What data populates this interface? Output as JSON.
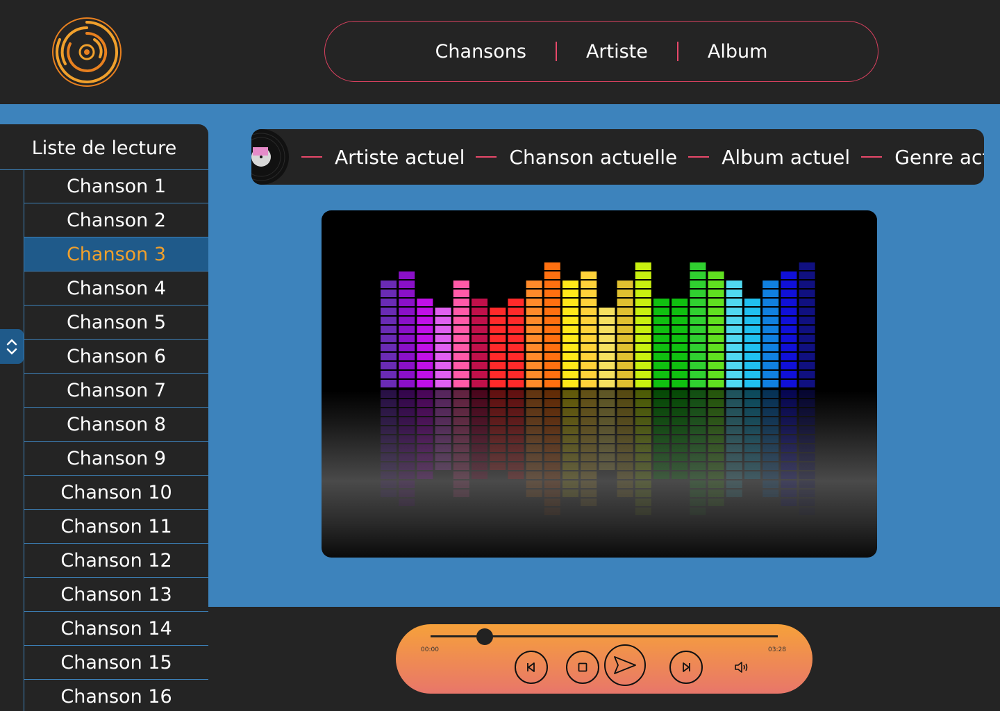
{
  "nav": {
    "items": [
      "Chansons",
      "Artiste",
      "Album"
    ]
  },
  "playlist": {
    "title": "Liste de lecture",
    "songs": [
      "Chanson 1",
      "Chanson 2",
      "Chanson 3",
      "Chanson 4",
      "Chanson 5",
      "Chanson 6",
      "Chanson 7",
      "Chanson 8",
      "Chanson 9",
      "Chanson 10",
      "Chanson 11",
      "Chanson 12",
      "Chanson 13",
      "Chanson 14",
      "Chanson 15",
      "Chanson 16"
    ],
    "active_index": 2
  },
  "now_playing": {
    "artist": "Artiste actuel",
    "song": "Chanson actuelle",
    "album": "Album actuel",
    "genre": "Genre actuel"
  },
  "player": {
    "time_current": "00:00",
    "time_total": "03:28",
    "progress": 0.155
  },
  "colors": {
    "background": "#242424",
    "stage": "#3d83bc",
    "accent_orange": "#f0a02c",
    "accent_pink": "#e8486a",
    "active_row": "#1f5a8a"
  },
  "icons": {
    "logo": "vinyl-logo-icon",
    "scroll": "chevron-up-down-icon",
    "prev": "skip-back-icon",
    "stop": "stop-icon",
    "play": "play-icon",
    "next": "skip-forward-icon",
    "volume": "volume-icon"
  }
}
